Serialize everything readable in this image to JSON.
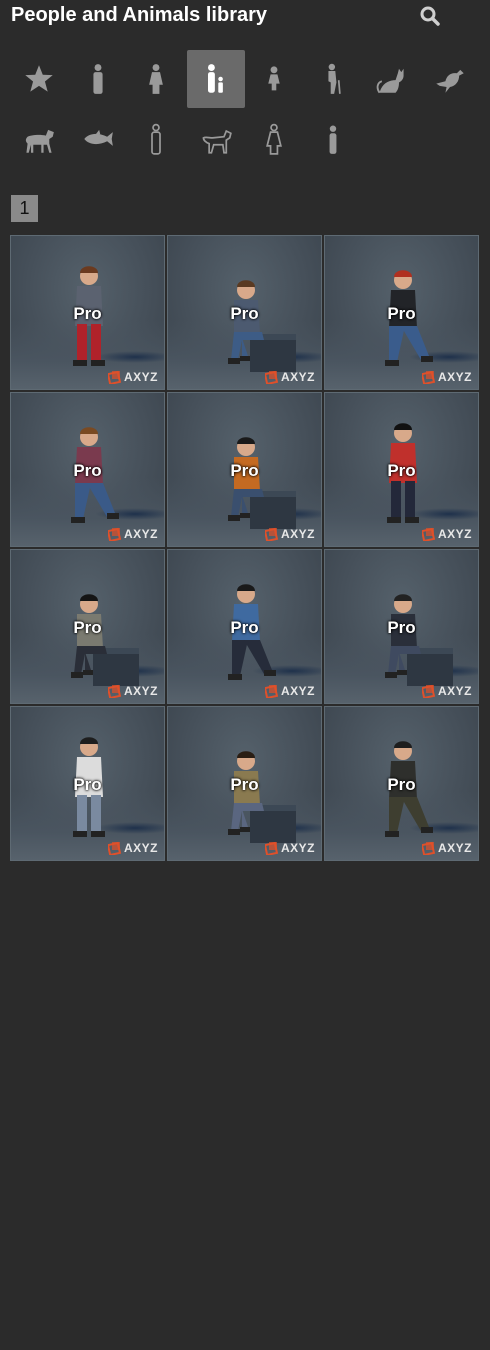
{
  "header": {
    "title": "People and Animals library",
    "search_icon": "search-icon"
  },
  "categories": [
    {
      "name": "favorites",
      "icon": "star-icon",
      "active": false
    },
    {
      "name": "men",
      "icon": "man-icon",
      "active": false
    },
    {
      "name": "women",
      "icon": "woman-icon",
      "active": false
    },
    {
      "name": "children",
      "icon": "child-icon",
      "active": true
    },
    {
      "name": "girls",
      "icon": "girl-icon",
      "active": false
    },
    {
      "name": "elderly",
      "icon": "elderly-icon",
      "active": false
    },
    {
      "name": "cats",
      "icon": "cat-icon",
      "active": false
    },
    {
      "name": "birds",
      "icon": "bird-icon",
      "active": false
    },
    {
      "name": "horses",
      "icon": "horse-icon",
      "active": false
    },
    {
      "name": "fish",
      "icon": "fish-icon",
      "active": false
    },
    {
      "name": "man-outline",
      "icon": "man-outline-icon",
      "active": false
    },
    {
      "name": "dogs",
      "icon": "dog-icon",
      "active": false
    },
    {
      "name": "woman-outline",
      "icon": "woman-outline-icon",
      "active": false
    },
    {
      "name": "person-small",
      "icon": "person-small-icon",
      "active": false
    }
  ],
  "pagination": {
    "current_page": "1"
  },
  "items": [
    {
      "badge": "Pro",
      "brand": "AXYZ",
      "pose": "standing",
      "shirt": "#5b6270",
      "pants": "#b0222a",
      "hair": "#6b3a1f"
    },
    {
      "badge": "Pro",
      "brand": "AXYZ",
      "pose": "sitting",
      "shirt": "#4c5a70",
      "pants": "#3d5c86",
      "hair": "#5a3a22"
    },
    {
      "badge": "Pro",
      "brand": "AXYZ",
      "pose": "walking",
      "shirt": "#222428",
      "pants": "#3a5c8c",
      "hair": "#b03020"
    },
    {
      "badge": "Pro",
      "brand": "AXYZ",
      "pose": "walking",
      "shirt": "#7a3a4e",
      "pants": "#3a5a88",
      "hair": "#7a4a22"
    },
    {
      "badge": "Pro",
      "brand": "AXYZ",
      "pose": "sitting",
      "shirt": "#c46a22",
      "pants": "#3a4f6e",
      "hair": "#1a1a1a"
    },
    {
      "badge": "Pro",
      "brand": "AXYZ",
      "pose": "standing",
      "shirt": "#c0302c",
      "pants": "#23283a",
      "hair": "#111111"
    },
    {
      "badge": "Pro",
      "brand": "AXYZ",
      "pose": "sitting",
      "shirt": "#7a7a70",
      "pants": "#2a2e38",
      "hair": "#151515"
    },
    {
      "badge": "Pro",
      "brand": "AXYZ",
      "pose": "walking",
      "shirt": "#3f6aa0",
      "pants": "#262c3a",
      "hair": "#1a1a1a"
    },
    {
      "badge": "Pro",
      "brand": "AXYZ",
      "pose": "sitting",
      "shirt": "#2a2f3a",
      "pants": "#3f4a60",
      "hair": "#222222"
    },
    {
      "badge": "Pro",
      "brand": "AXYZ",
      "pose": "standing",
      "shirt": "#dcdcdc",
      "pants": "#7a8aa0",
      "hair": "#1e1e1e"
    },
    {
      "badge": "Pro",
      "brand": "AXYZ",
      "pose": "sitting",
      "shirt": "#8a7a50",
      "pants": "#5a6680",
      "hair": "#2a1e14"
    },
    {
      "badge": "Pro",
      "brand": "AXYZ",
      "pose": "walking",
      "shirt": "#2e2f2c",
      "pants": "#3e3e30",
      "hair": "#1e1e1e"
    }
  ],
  "colors": {
    "background": "#2b2b2b",
    "active_category": "#6a6a6a",
    "icon_gray": "#9a9a9a",
    "page_badge": "#8a8a8a",
    "brand_orange": "#e0502a"
  }
}
